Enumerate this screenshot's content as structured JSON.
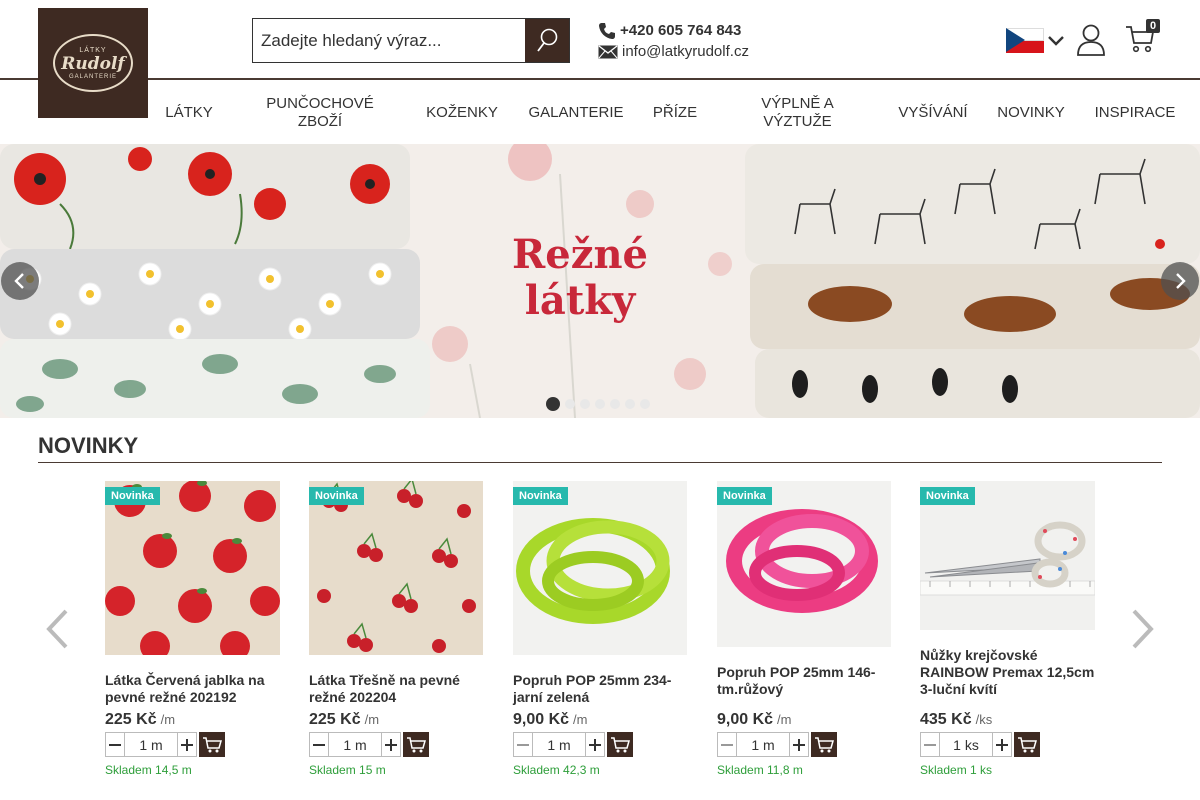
{
  "logo": {
    "top": "LÁTKY",
    "main": "Rudolf",
    "bottom": "GALANTERIE"
  },
  "search": {
    "placeholder": "Zadejte hledaný výraz..."
  },
  "contact": {
    "phone": "+420 605 764 843",
    "email": "info@latkyrudolf.cz"
  },
  "language": {
    "current": "Czech",
    "icon": "czech-flag"
  },
  "cart": {
    "count": "0"
  },
  "nav": [
    {
      "label": "LÁTKY"
    },
    {
      "label": "PUNČOCHOVÉ ZBOŽÍ"
    },
    {
      "label": "KOŽENKY"
    },
    {
      "label": "GALANTERIE"
    },
    {
      "label": "PŘÍZE"
    },
    {
      "label": "VÝPLNĚ A VÝZTUŽE"
    },
    {
      "label": "VYŠÍVÁNÍ"
    },
    {
      "label": "NOVINKY"
    },
    {
      "label": "INSPIRACE"
    }
  ],
  "banner": {
    "title_line1": "Režné",
    "title_line2": "látky",
    "slide_count": 7,
    "active_slide": 0
  },
  "novinky": {
    "title": "NOVINKY",
    "products": [
      {
        "badge": "Novinka",
        "name": "Látka Červená jablka na pevné režné 202192",
        "price": "225 Kč",
        "unit": "/m",
        "qty": "1 m",
        "stock": "Skladem 14,5 m",
        "image": "red-apples-fabric"
      },
      {
        "badge": "Novinka",
        "name": "Látka Třešně na pevné režné 202204",
        "price": "225 Kč",
        "unit": "/m",
        "qty": "1 m",
        "stock": "Skladem 15 m",
        "image": "cherries-fabric"
      },
      {
        "badge": "Novinka",
        "name": "Popruh POP 25mm 234-jarní zelená",
        "price": "9,00 Kč",
        "unit": "/m",
        "qty": "1 m",
        "stock": "Skladem 42,3 m",
        "image": "green-strap"
      },
      {
        "badge": "Novinka",
        "name": "Popruh POP 25mm 146-tm.růžový",
        "price": "9,00 Kč",
        "unit": "/m",
        "qty": "1 m",
        "stock": "Skladem 11,8 m",
        "image": "pink-strap"
      },
      {
        "badge": "Novinka",
        "name": "Nůžky krejčovské RAINBOW Premax 12,5cm 3-luční kvítí",
        "price": "435 Kč",
        "unit": "/ks",
        "qty": "1 ks",
        "stock": "Skladem 1 ks",
        "image": "tailor-scissors"
      }
    ]
  },
  "colors": {
    "brand": "#3e2a22",
    "badge": "#27b9ad",
    "stock": "#2e9e3a",
    "banner_title": "#c8283a"
  }
}
